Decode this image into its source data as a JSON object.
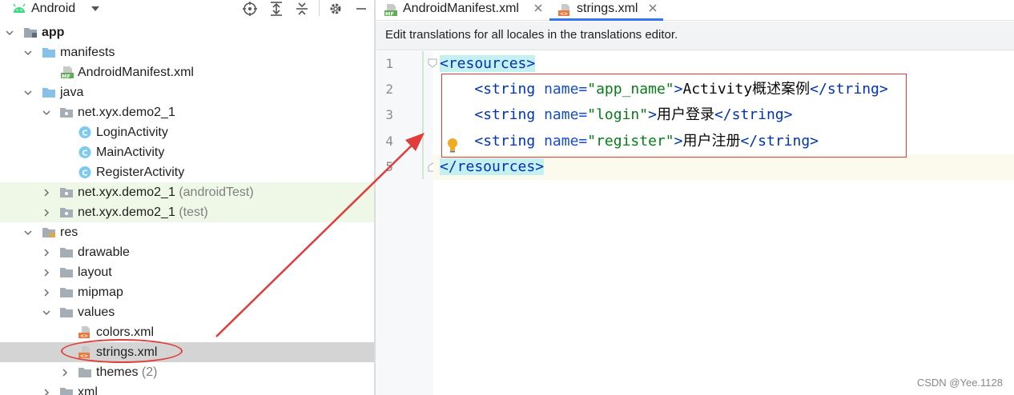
{
  "project_panel": {
    "view_selector": "Android",
    "tree": [
      {
        "label": "app",
        "bold": true,
        "suffix": ""
      },
      {
        "label": "manifests",
        "suffix": ""
      },
      {
        "label": "AndroidManifest.xml",
        "suffix": ""
      },
      {
        "label": "java",
        "suffix": ""
      },
      {
        "label": "net.xyx.demo2_1",
        "suffix": ""
      },
      {
        "label": "LoginActivity",
        "suffix": ""
      },
      {
        "label": "MainActivity",
        "suffix": ""
      },
      {
        "label": "RegisterActivity",
        "suffix": ""
      },
      {
        "label": "net.xyx.demo2_1",
        "suffix": "(androidTest)"
      },
      {
        "label": "net.xyx.demo2_1",
        "suffix": "(test)"
      },
      {
        "label": "res",
        "suffix": ""
      },
      {
        "label": "drawable",
        "suffix": ""
      },
      {
        "label": "layout",
        "suffix": ""
      },
      {
        "label": "mipmap",
        "suffix": ""
      },
      {
        "label": "values",
        "suffix": ""
      },
      {
        "label": "colors.xml",
        "suffix": ""
      },
      {
        "label": "strings.xml",
        "suffix": ""
      },
      {
        "label": "themes",
        "suffix": "(2)"
      },
      {
        "label": "xml",
        "suffix": ""
      }
    ]
  },
  "editor": {
    "tabs": [
      {
        "label": "AndroidManifest.xml",
        "active": false
      },
      {
        "label": "strings.xml",
        "active": true
      }
    ],
    "banner": "Edit translations for all locales in the translations editor.",
    "line_numbers": [
      "1",
      "2",
      "3",
      "4",
      "5"
    ],
    "code": {
      "open_root": "<resources>",
      "close_root": "</resources>",
      "string_open": "<string",
      "string_close": "</string>",
      "attr_name": "name=",
      "gt": ">",
      "lines": [
        {
          "name_value": "\"app_name\"",
          "text_latin": "Activity",
          "text_cjk": "概述案例"
        },
        {
          "name_value": "\"login\"",
          "text_latin": "",
          "text_cjk": "用户登录"
        },
        {
          "name_value": "\"register\"",
          "text_latin": "",
          "text_cjk": "用户注册"
        }
      ]
    }
  },
  "watermark": "CSDN @Yee.1128",
  "colors": {
    "annotation_red": "#e03c3c",
    "keyword_blue": "#0033b3",
    "string_green": "#067d17",
    "selection_gray": "#d4d4d4",
    "test_row_green": "#eff8e6"
  }
}
